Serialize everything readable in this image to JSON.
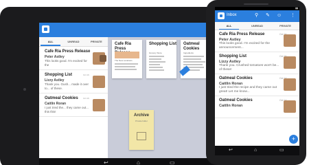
{
  "tablet": {
    "tabs": [
      "ALL",
      "UNREAD",
      "PRIVATE"
    ],
    "list": [
      {
        "title": "Cafe Ria Press Release",
        "date": "Oct 16",
        "from": "Peter Astley",
        "snippet": "This looks good. I'm excited for the"
      },
      {
        "title": "Shopping List",
        "date": "Oct 16",
        "from": "Lizzy Astley",
        "snippet": "Thank you. Gush... made it over to... of these."
      },
      {
        "title": "Oatmeal Cookies",
        "date": "Oct 16",
        "from": "Caitlin Roran",
        "snippet": "I just tried the... they came out... this this!"
      }
    ],
    "cards": [
      {
        "title": "Cafe Ria Press Release",
        "subtitle": "The New Locations"
      },
      {
        "title": "Shopping List",
        "subtitle": "Grocery Store"
      },
      {
        "title": "Oatmeal Cookies",
        "subtitle": "Ingredients"
      }
    ],
    "archive": {
      "title": "Archive",
      "subtitle": "Private folder"
    }
  },
  "phone": {
    "app_title": "Inbox",
    "tabs": [
      "ALL",
      "UNREAD",
      "PRIVATE"
    ],
    "list": [
      {
        "title": "Cafe Ria Press Release",
        "date": "Oct 16",
        "from": "Peter Astley",
        "snippet": "This looks good. I'm excited for the announcement..."
      },
      {
        "title": "Shopping List",
        "date": "Oct 15",
        "from": "Lizzy Astley",
        "snippet": "Thank you. Crushed tomatoes won't be... of these!"
      },
      {
        "title": "Oatmeal Cookies",
        "date": "Oct 14",
        "from": "Caitlin Roran",
        "snippet": "I just tried the recipe and they came out great! Let me know..."
      },
      {
        "title": "Oatmeal Cookies",
        "date": "Oct 14",
        "from": "Caitlin Roran",
        "snippet": ""
      }
    ]
  }
}
